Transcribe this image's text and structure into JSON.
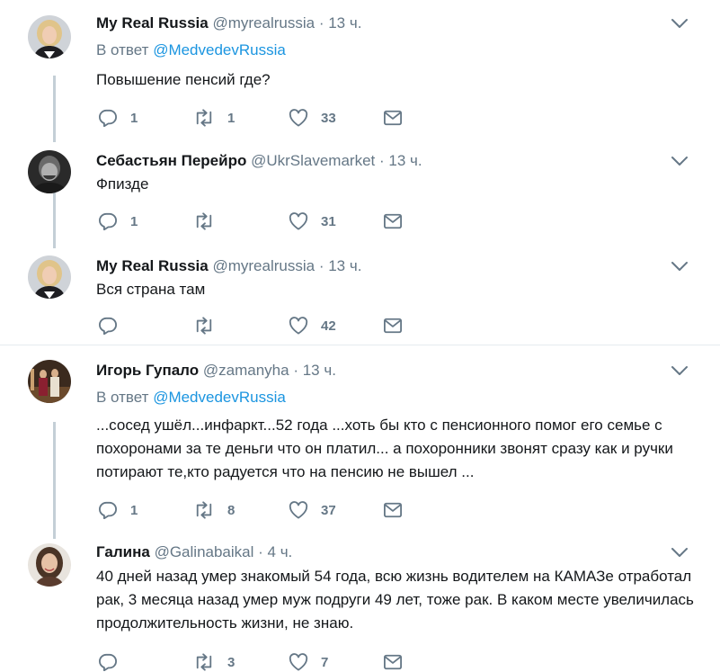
{
  "tweets": [
    {
      "name": "My Real Russia",
      "handle": "@myrealrussia",
      "sep": " · ",
      "time": "13 ч.",
      "reply_prefix": "В ответ",
      "reply_to": "@MedvedevRussia",
      "text": "Повышение пенсий где?",
      "replies": "1",
      "retweets": "1",
      "likes": "33",
      "avatar_icon": "avatar-woman-blonde"
    },
    {
      "name": "Себастьян Перейро",
      "handle": "@UkrSlavemarket",
      "sep": " · ",
      "time": "13 ч.",
      "text": "Фпизде",
      "replies": "1",
      "retweets": "",
      "likes": "31",
      "avatar_icon": "avatar-man-bw"
    },
    {
      "name": "My Real Russia",
      "handle": "@myrealrussia",
      "sep": " · ",
      "time": "13 ч.",
      "text": "Вся страна там",
      "replies": "",
      "retweets": "",
      "likes": "42",
      "avatar_icon": "avatar-woman-blonde"
    },
    {
      "name": "Игорь Гупало",
      "handle": "@zamanyha",
      "sep": " · ",
      "time": "13 ч.",
      "reply_prefix": "В ответ",
      "reply_to": "@MedvedevRussia",
      "text": "...сосед ушёл...инфаркт...52 года ...хоть бы кто с пенсионного помог его семье с похоронами за те деньги что он платил... а похоронники звонят сразу как и ручки потирают те,кто радуется что на пенсию не вышел ...",
      "replies": "1",
      "retweets": "8",
      "likes": "37",
      "avatar_icon": "avatar-stage-people"
    },
    {
      "name": "Галина",
      "handle": "@Galinabaikal",
      "sep": " · ",
      "time": "4 ч.",
      "text": "40 дней назад умер знакомый 54 года, всю жизнь водителем на КАМАЗе отработал рак, 3 месяца назад умер муж подруги 49 лет,  тоже рак. В каком месте увеличилась продолжительность жизни, не знаю.",
      "replies": "",
      "retweets": "3",
      "likes": "7",
      "avatar_icon": "avatar-woman-dark-hair"
    }
  ],
  "icons": {
    "reply": "reply-icon",
    "retweet": "retweet-icon",
    "like": "like-icon",
    "message": "direct-message-icon",
    "caret": "chevron-down-icon"
  },
  "colors": {
    "text": "#14171a",
    "secondary": "#657786",
    "link": "#1b95e0",
    "thread_line": "#c4cfd6",
    "divider": "#e6ecf0"
  }
}
